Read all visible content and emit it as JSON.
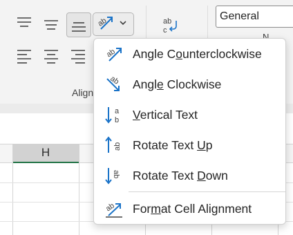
{
  "ribbon": {
    "group_label": "Align",
    "number_format": "General",
    "number_group_label_fragment": "N"
  },
  "sheet": {
    "column_header": "H"
  },
  "orientation_menu": {
    "items": [
      {
        "pre": "Angle C",
        "key": "o",
        "post": "unterclockwise",
        "icon": "angle-counterclockwise-icon"
      },
      {
        "pre": "Angl",
        "key": "e",
        "post": " Clockwise",
        "icon": "angle-clockwise-icon"
      },
      {
        "pre": "",
        "key": "V",
        "post": "ertical Text",
        "icon": "vertical-text-icon"
      },
      {
        "pre": "Rotate Text ",
        "key": "U",
        "post": "p",
        "icon": "rotate-text-up-icon"
      },
      {
        "pre": "Rotate Text ",
        "key": "D",
        "post": "own",
        "icon": "rotate-text-down-icon"
      },
      {
        "pre": "For",
        "key": "m",
        "post": "at Cell Alignment",
        "icon": "format-cell-alignment-icon"
      }
    ]
  },
  "colors": {
    "accent": "#1a73c8",
    "excel_green": "#217346"
  }
}
